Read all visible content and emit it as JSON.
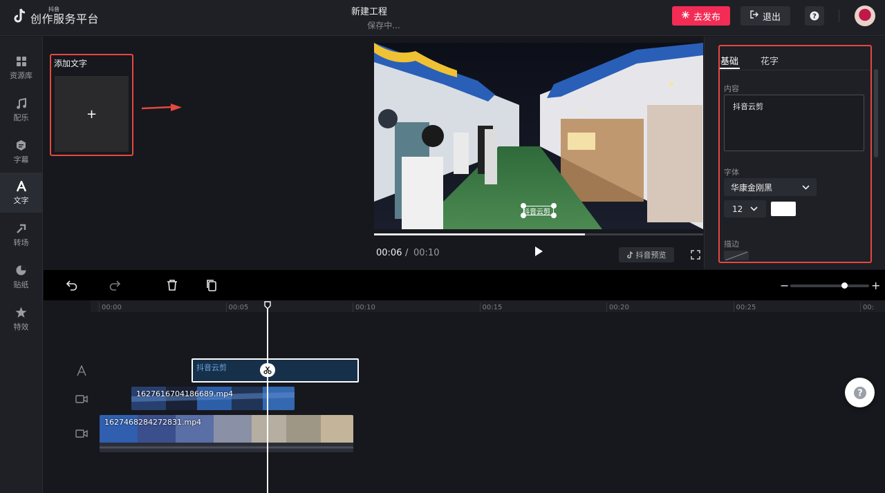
{
  "app": {
    "logo_small": "抖音",
    "logo_main": "创作服务平台",
    "project_title": "新建工程",
    "project_status": "保存中...",
    "publish_label": "去发布",
    "exit_label": "退出",
    "help_label": "?"
  },
  "sidebar": {
    "items": [
      {
        "label": "资源库",
        "icon": "grid-icon"
      },
      {
        "label": "配乐",
        "icon": "music-note-icon"
      },
      {
        "label": "字幕",
        "icon": "subtitle-icon"
      },
      {
        "label": "文字",
        "icon": "text-a-icon"
      },
      {
        "label": "转场",
        "icon": "transition-icon"
      },
      {
        "label": "贴纸",
        "icon": "sticker-icon"
      },
      {
        "label": "特效",
        "icon": "effect-star-icon"
      }
    ],
    "active_index": 3
  },
  "resource": {
    "add_text_title": "添加文字",
    "add_text_plus": "+"
  },
  "preview": {
    "overlay_text": "抖音云剪",
    "time_current": "00:06",
    "time_separator": "/",
    "time_total": "00:10",
    "progress": 0.64,
    "preview_button_label": "抖音预览"
  },
  "properties": {
    "tabs": [
      "基础",
      "花字"
    ],
    "active_tab": 0,
    "content_label": "内容",
    "content_value": "抖音云剪",
    "font_label": "字体",
    "font_value": "华康金刚黑",
    "size_value": "12",
    "color_value": "#ffffff",
    "stroke_label": "描边"
  },
  "toolbar": {
    "zoom_minus": "−",
    "zoom_plus": "+",
    "zoom_level": 0.7
  },
  "timeline": {
    "ticks": [
      "00:00",
      "00:05",
      "00:10",
      "00:15",
      "00:20",
      "00:25",
      "00:"
    ],
    "text_clip_label": "抖音云剪",
    "video_clips": [
      "1627616704186689.mp4",
      "1627468284272831.mp4"
    ]
  },
  "colors": {
    "accent": "#f22c55",
    "highlight_border": "#e8473f",
    "text_clip_bg": "#17304a"
  }
}
